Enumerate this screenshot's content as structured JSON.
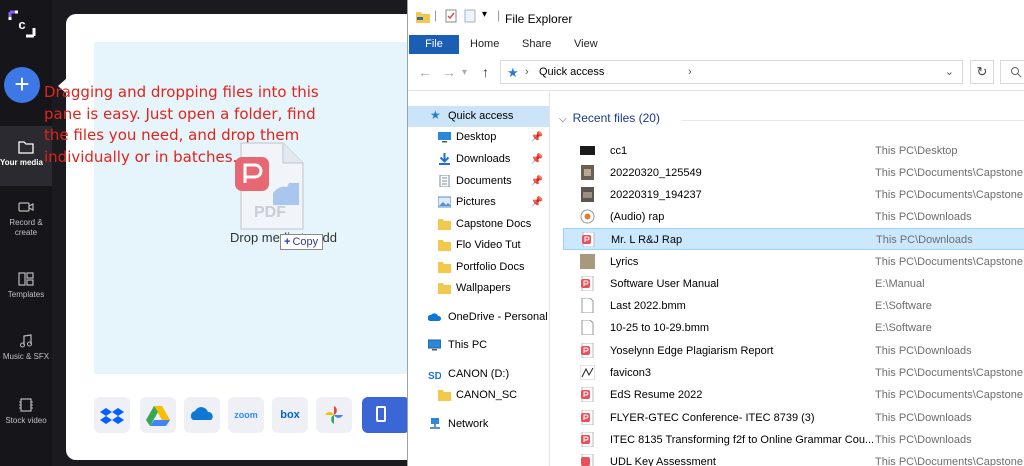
{
  "rail": {
    "items": [
      {
        "label": "Your media",
        "icon": "folder-icon"
      },
      {
        "label": "Record & create",
        "icon": "video-camera-icon"
      },
      {
        "label": "Templates",
        "icon": "templates-icon"
      },
      {
        "label": "Music & SFX",
        "icon": "music-note-icon"
      },
      {
        "label": "Stock video",
        "icon": "film-icon"
      }
    ]
  },
  "upload": {
    "caption": "Dragging and dropping files into this pane is easy. Just open a folder, find the files you need, and drop them individually or in batches.",
    "drop_text": "Drop media to add",
    "copy_tooltip": "Copy",
    "drag_file_type": "PDF",
    "sources": [
      "dropbox",
      "google-drive",
      "onedrive",
      "zoom",
      "box",
      "google-photos"
    ],
    "source_labels": {
      "zoom": "zoom",
      "box": "box"
    }
  },
  "explorer": {
    "title": "File Explorer",
    "tabs": [
      "File",
      "Home",
      "Share",
      "View"
    ],
    "address": "Quick access",
    "nav": [
      {
        "label": "Quick access",
        "icon": "star-icon",
        "selected": true
      },
      {
        "label": "Desktop",
        "icon": "desktop-icon",
        "pinned": true
      },
      {
        "label": "Downloads",
        "icon": "download-icon",
        "pinned": true
      },
      {
        "label": "Documents",
        "icon": "documents-icon",
        "pinned": true
      },
      {
        "label": "Pictures",
        "icon": "pictures-icon",
        "pinned": true
      },
      {
        "label": "Capstone Docs",
        "icon": "folder-icon"
      },
      {
        "label": "Flo Video Tut",
        "icon": "folder-icon"
      },
      {
        "label": "Portfolio Docs",
        "icon": "folder-icon"
      },
      {
        "label": "Wallpapers",
        "icon": "folder-icon"
      },
      {
        "label": "OneDrive - Personal",
        "icon": "cloud-icon"
      },
      {
        "label": "This PC",
        "icon": "computer-icon"
      },
      {
        "label": "CANON (D:)",
        "icon": "sd-card-icon"
      },
      {
        "label": "CANON_SC",
        "icon": "folder-icon"
      },
      {
        "label": "Network",
        "icon": "network-icon"
      }
    ],
    "group_title": "Recent files (20)",
    "files": [
      {
        "name": "cc1",
        "path": "This PC\\Desktop",
        "icon": "image-thumb-dark"
      },
      {
        "name": "20220320_125549",
        "path": "This PC\\Documents\\Capstone D",
        "icon": "image-thumb"
      },
      {
        "name": "20220319_194237",
        "path": "This PC\\Documents\\Capstone D",
        "icon": "image-thumb"
      },
      {
        "name": "(Audio) rap",
        "path": "This PC\\Downloads",
        "icon": "audio-icon"
      },
      {
        "name": "Mr. L R&J Rap",
        "path": "This PC\\Downloads",
        "icon": "pdf-icon",
        "selected": true
      },
      {
        "name": "Lyrics",
        "path": "This PC\\Documents\\Capstone D",
        "icon": "image-thumb-tan"
      },
      {
        "name": "Software User Manual",
        "path": "E:\\Manual",
        "icon": "pdf-icon"
      },
      {
        "name": "Last 2022.bmm",
        "path": "E:\\Software",
        "icon": "blank-file-icon"
      },
      {
        "name": "10-25 to 10-29.bmm",
        "path": "E:\\Software",
        "icon": "blank-file-icon"
      },
      {
        "name": "Yoselynn Edge Plagiarism Report",
        "path": "This PC\\Downloads",
        "icon": "pdf-icon"
      },
      {
        "name": "favicon3",
        "path": "This PC\\Documents\\Capstone D",
        "icon": "image-thumb-sketch"
      },
      {
        "name": "EdS Resume 2022",
        "path": "This PC\\Documents\\Capstone D",
        "icon": "pdf-icon"
      },
      {
        "name": "FLYER-GTEC Conference- ITEC 8739 (3)",
        "path": "This PC\\Downloads",
        "icon": "pdf-icon"
      },
      {
        "name": "ITEC 8135 Transforming f2f to Online Grammar Cou...",
        "path": "This PC\\Downloads",
        "icon": "pdf-icon"
      },
      {
        "name": "UDL Key Assessment",
        "path": "This PC\\Documents\\Capstone D",
        "icon": "pdf-icon"
      }
    ]
  }
}
